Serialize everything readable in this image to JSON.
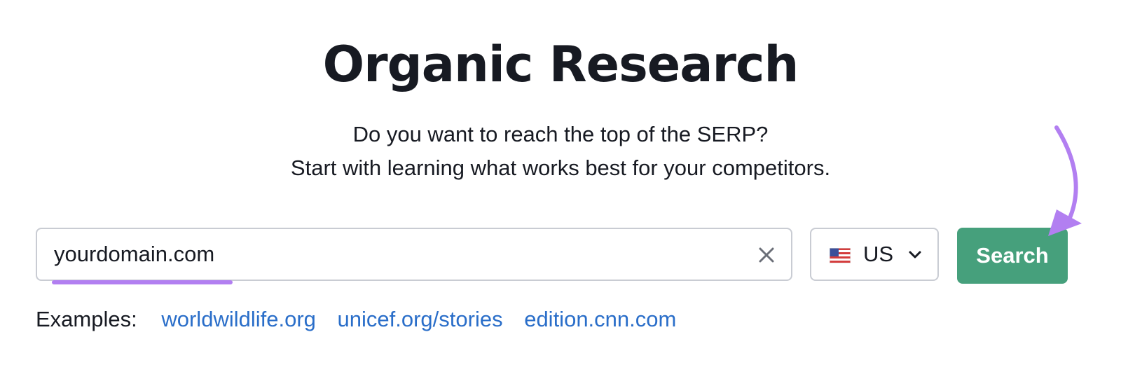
{
  "page": {
    "title": "Organic Research",
    "subtitle_line1": "Do you want to reach the top of the SERP?",
    "subtitle_line2": "Start with learning what works best for your competitors."
  },
  "search": {
    "value": "yourdomain.com",
    "clear_icon": "close-icon"
  },
  "country": {
    "flag_icon": "us-flag-icon",
    "label": "US",
    "dropdown_icon": "chevron-down-icon"
  },
  "search_button": {
    "label": "Search"
  },
  "examples": {
    "label": "Examples:",
    "links": [
      "worldwildlife.org",
      "unicef.org/stories",
      "edition.cnn.com"
    ]
  },
  "colors": {
    "button_green": "#46a07c",
    "link_blue": "#2a6ec9",
    "annotation_purple": "#b27ff1",
    "border_gray": "#c9ccd3",
    "text_dark": "#171a22"
  }
}
